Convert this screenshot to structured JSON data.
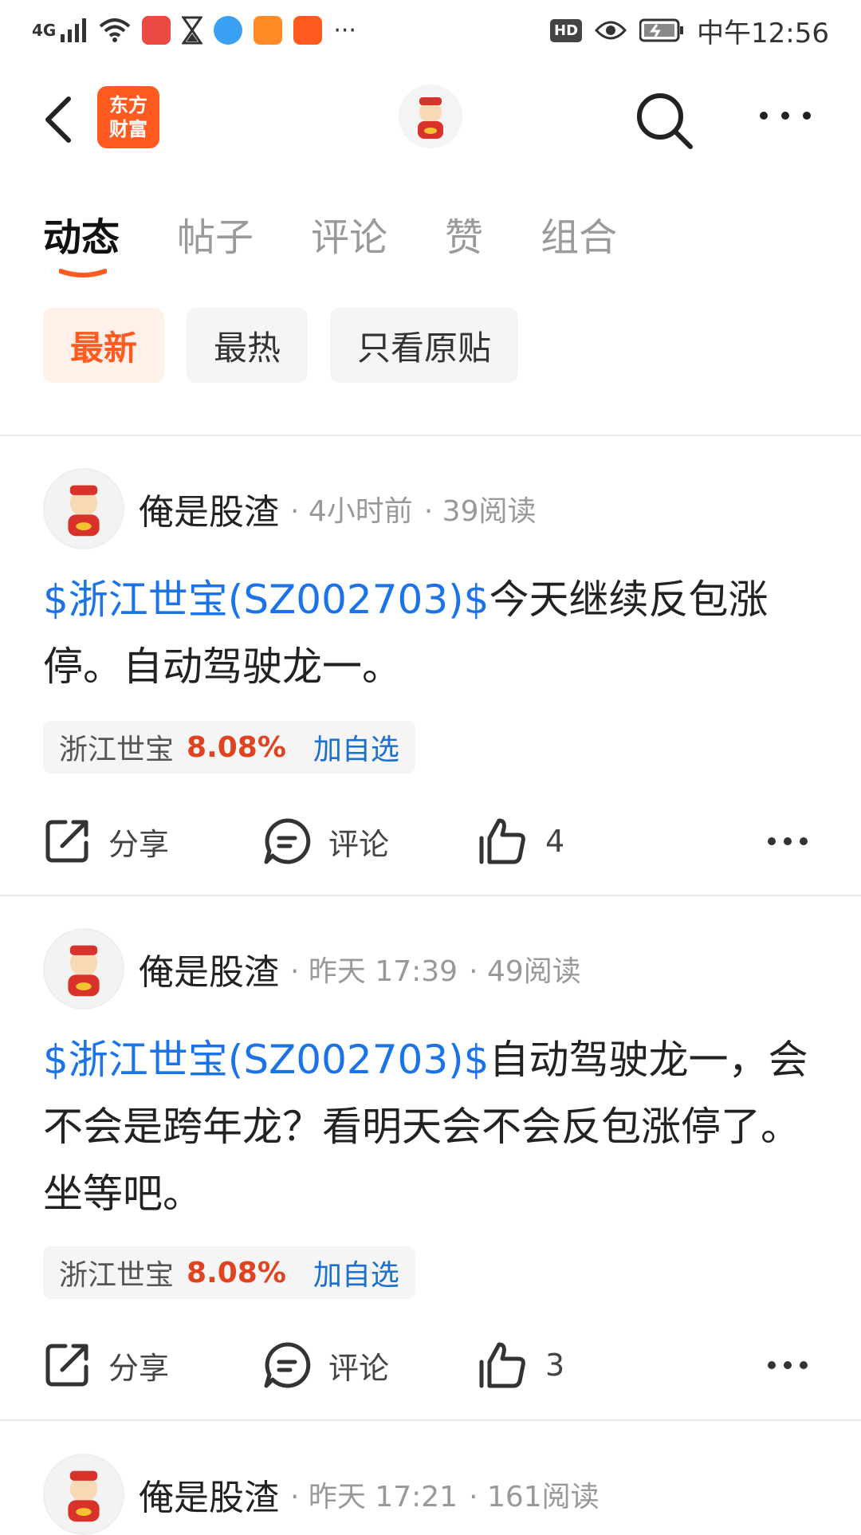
{
  "status_bar": {
    "network": "4G",
    "time": "中午12:56",
    "hd_badge": "HD"
  },
  "header": {
    "logo_text_line1": "东方",
    "logo_text_line2": "财富",
    "brand_color": "#ff5a1f"
  },
  "tabs": [
    {
      "label": "动态",
      "active": true
    },
    {
      "label": "帖子",
      "active": false
    },
    {
      "label": "评论",
      "active": false
    },
    {
      "label": "赞",
      "active": false
    },
    {
      "label": "组合",
      "active": false
    }
  ],
  "filters": [
    {
      "label": "最新",
      "active": true
    },
    {
      "label": "最热",
      "active": false
    },
    {
      "label": "只看原贴",
      "active": false
    }
  ],
  "posts": [
    {
      "user": "俺是股渣",
      "time": "· 4小时前",
      "reads": "· 39阅读",
      "stock_link": "$浙江世宝(SZ002703)$",
      "text": "今天继续反包涨停。自动驾驶龙一。",
      "tag_name": "浙江世宝",
      "tag_pct": "8.08%",
      "tag_add": "加自选",
      "share_label": "分享",
      "comment_label": "评论",
      "likes": "4"
    },
    {
      "user": "俺是股渣",
      "time": "· 昨天 17:39",
      "reads": "· 49阅读",
      "stock_link": "$浙江世宝(SZ002703)$",
      "text": "自动驾驶龙一，会不会是跨年龙？看明天会不会反包涨停了。坐等吧。",
      "tag_name": "浙江世宝",
      "tag_pct": "8.08%",
      "tag_add": "加自选",
      "share_label": "分享",
      "comment_label": "评论",
      "likes": "3"
    },
    {
      "user": "俺是股渣",
      "time": "· 昨天 17:21",
      "reads": "· 161阅读"
    }
  ],
  "colors": {
    "stock_link": "#1a73e8",
    "percent_up": "#e0431f",
    "add_watch": "#1a6fd1"
  }
}
